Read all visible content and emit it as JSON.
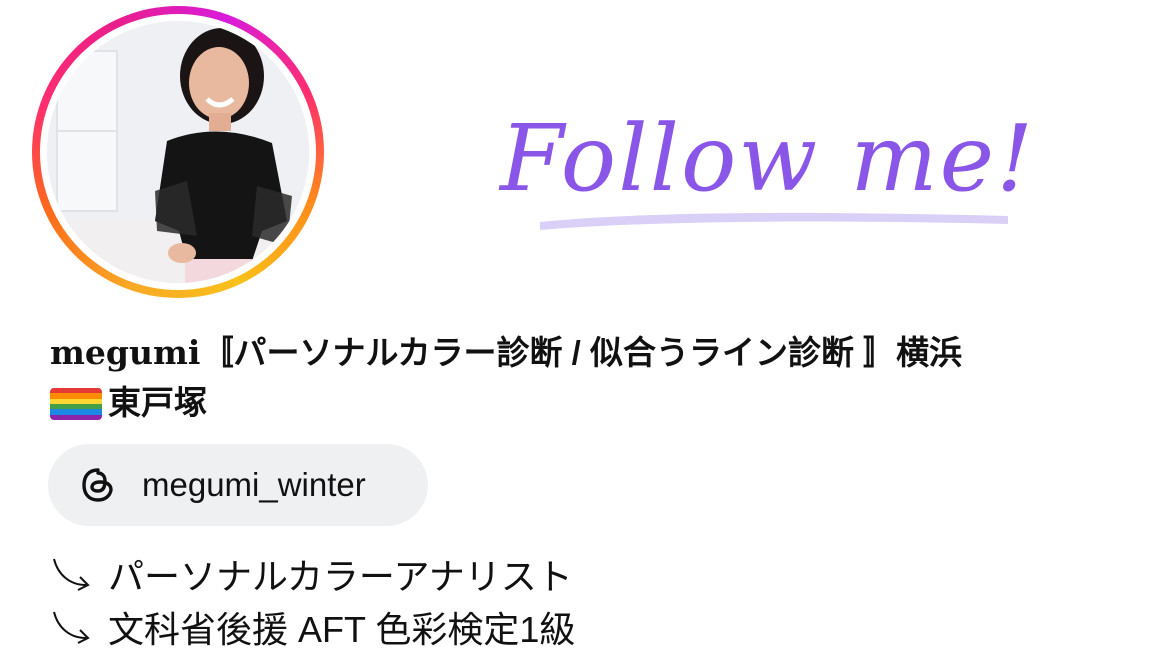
{
  "profile": {
    "display_name_latin": "megumi",
    "display_name_jp": "〚パーソナルカラー診断 / 似合うライン診断 〛横浜",
    "display_name_line2": "東戸塚",
    "follow_art_text": "Follow me!"
  },
  "threads": {
    "handle": "megumi_winter"
  },
  "bio": [
    {
      "text": "パーソナルカラーアナリスト"
    },
    {
      "text": "文科省後援 AFT 色彩検定1級"
    }
  ],
  "colors": {
    "follow_purple": "#8a56e8",
    "underline_lavender": "#d9cff7",
    "pill_bg": "#eff0f2"
  },
  "icons": {
    "flag": "rainbow-flag-icon",
    "threads": "threads-icon",
    "bio_bullet": "curved-arrow-icon"
  }
}
